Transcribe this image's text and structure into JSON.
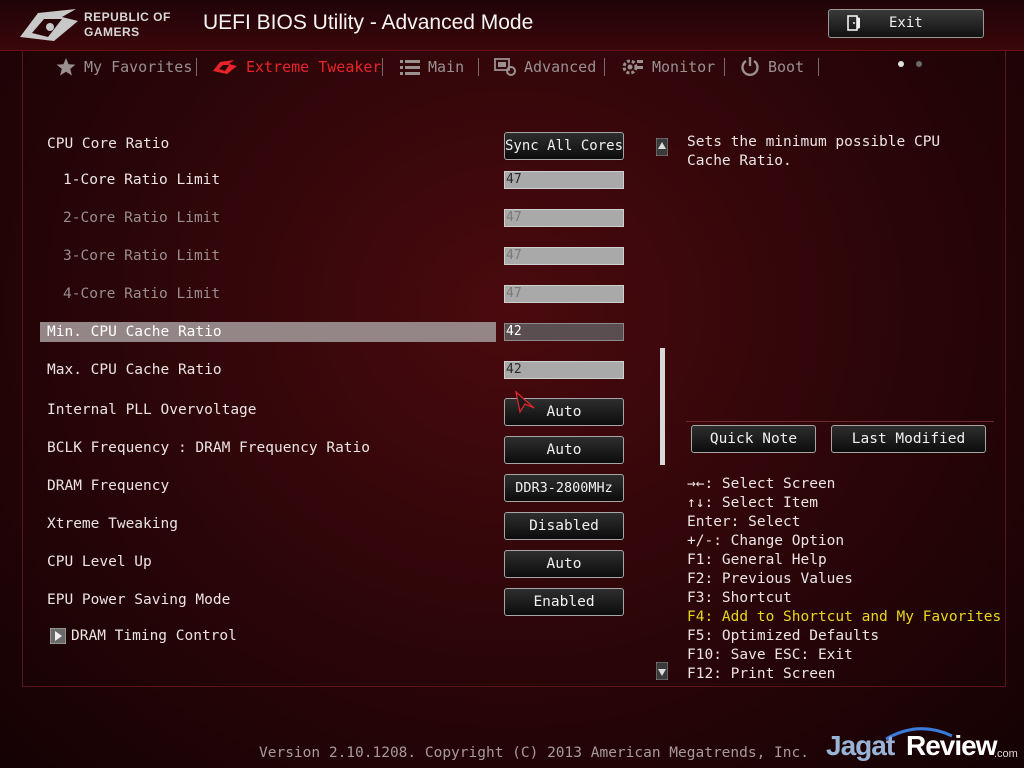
{
  "header": {
    "brand_line1": "REPUBLIC OF",
    "brand_line2": "GAMERS",
    "title": "UEFI BIOS Utility - Advanced Mode",
    "exit_label": "Exit"
  },
  "tabs": [
    {
      "label": "My Favorites",
      "icon": "star-icon"
    },
    {
      "label": "Extreme Tweaker",
      "icon": "rog-eye-icon",
      "active": true
    },
    {
      "label": "Main",
      "icon": "list-icon"
    },
    {
      "label": "Advanced",
      "icon": "advanced-icon"
    },
    {
      "label": "Monitor",
      "icon": "monitor-gear-icon"
    },
    {
      "label": "Boot",
      "icon": "power-icon"
    }
  ],
  "settings": [
    {
      "label": "CPU Core Ratio",
      "value": "Sync All Cores"
    },
    {
      "label": "1-Core Ratio Limit",
      "value": "47"
    },
    {
      "label": "2-Core Ratio Limit",
      "value": "47"
    },
    {
      "label": "3-Core Ratio Limit",
      "value": "47"
    },
    {
      "label": "4-Core Ratio Limit",
      "value": "47"
    },
    {
      "label": "Min. CPU Cache Ratio",
      "value": "42"
    },
    {
      "label": "Max. CPU Cache Ratio",
      "value": "42"
    },
    {
      "label": "Internal PLL Overvoltage",
      "value": "Auto"
    },
    {
      "label": "BCLK Frequency : DRAM Frequency Ratio",
      "value": "Auto"
    },
    {
      "label": "DRAM Frequency",
      "value": "DDR3-2800MHz"
    },
    {
      "label": "Xtreme Tweaking",
      "value": "Disabled"
    },
    {
      "label": "CPU Level Up",
      "value": "Auto"
    },
    {
      "label": "EPU Power Saving Mode",
      "value": "Enabled"
    },
    {
      "label": "DRAM Timing Control",
      "value": null
    }
  ],
  "help": {
    "description": "Sets the minimum possible CPU Cache Ratio.",
    "quick_note": "Quick Note",
    "last_modified": "Last Modified"
  },
  "keys": [
    "→←: Select Screen",
    "↑↓: Select Item",
    "Enter: Select",
    "+/-: Change Option",
    "F1: General Help",
    "F2: Previous Values",
    "F3: Shortcut",
    "F4: Add to Shortcut and My Favorites",
    "F5: Optimized Defaults",
    "F10: Save  ESC: Exit",
    "F12: Print Screen"
  ],
  "footer": {
    "version": "Version 2.10.1208. Copyright (C) 2013 American Megatrends, Inc."
  },
  "watermark": {
    "part1": "Jagat",
    "part2": "Review",
    "suffix": ".com"
  },
  "colors": {
    "accent": "#e8242b",
    "highlight_key": "#e8d81c",
    "selected_row": "#948686"
  }
}
